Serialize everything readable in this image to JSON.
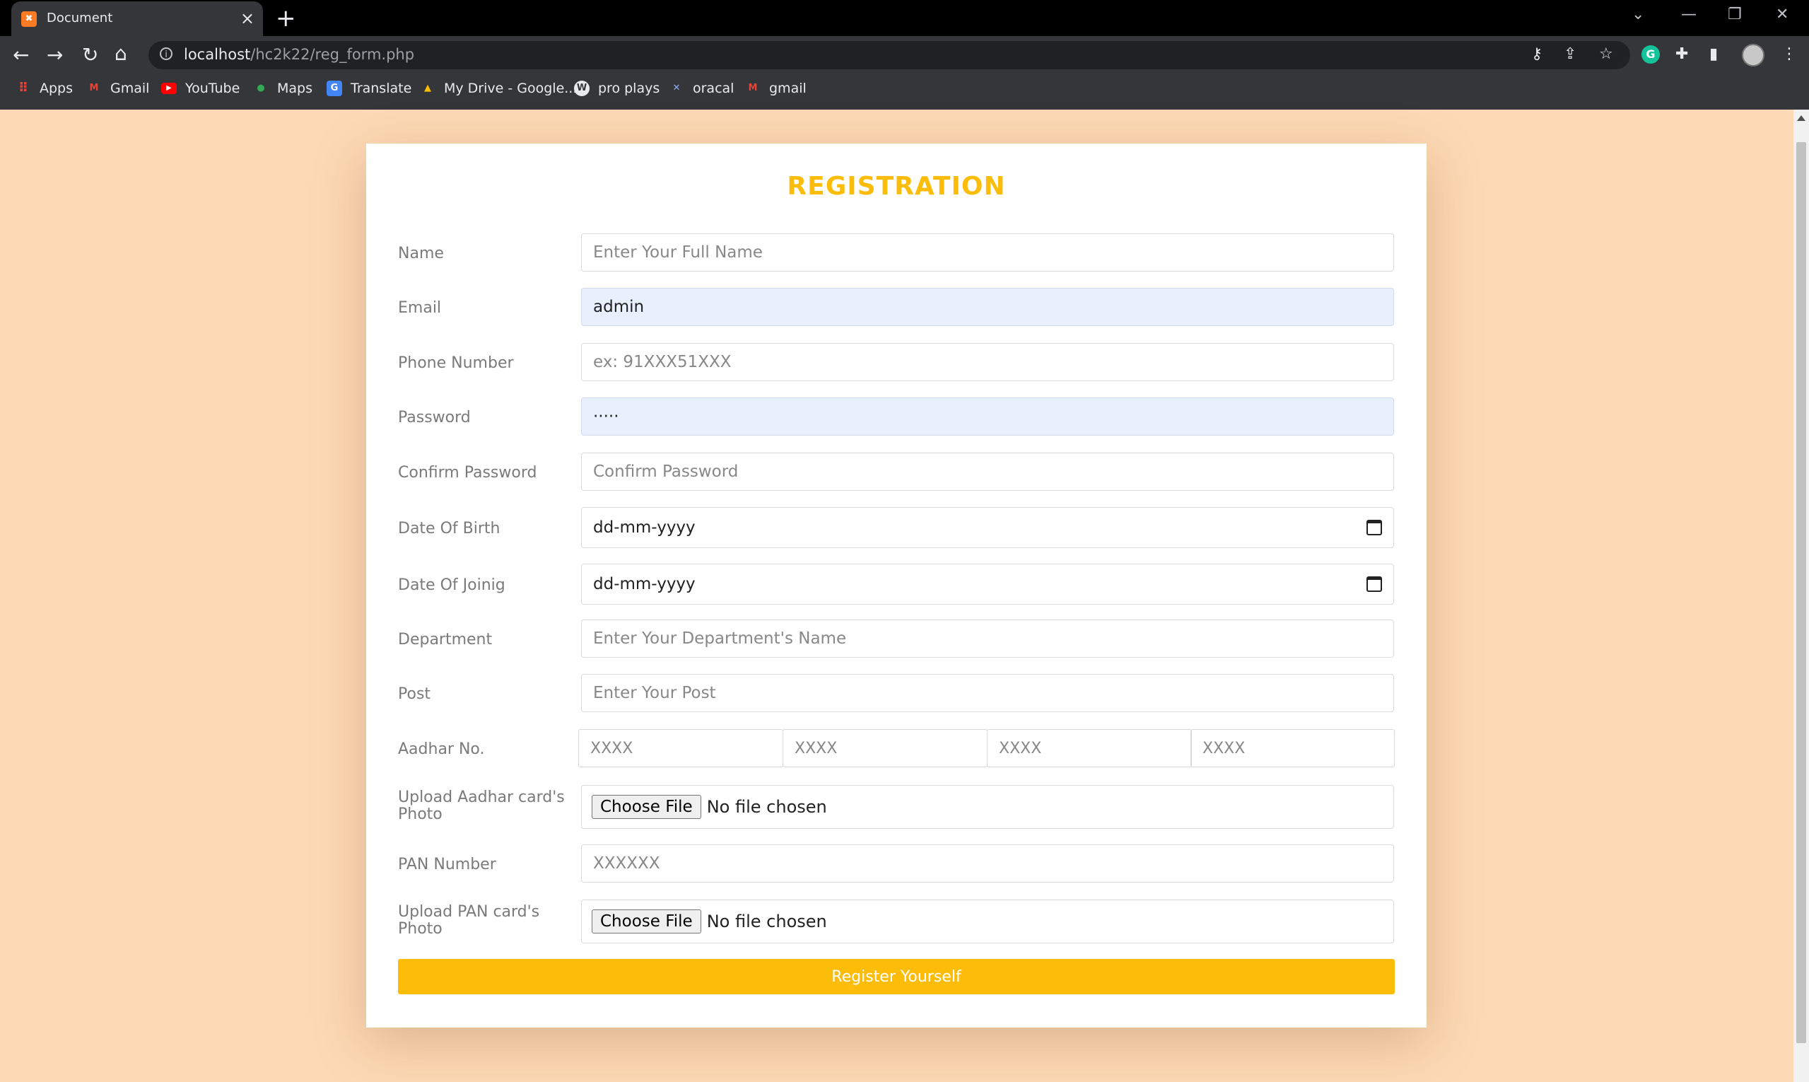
{
  "browser": {
    "tab_title": "Document",
    "tab_favicon": "XAMPP",
    "url_host": "localhost",
    "url_path": "/hc2k22/reg_form.php",
    "bookmarks": [
      {
        "label": "Apps",
        "icon": "apps-grid-icon",
        "color": "#ea4335"
      },
      {
        "label": "Gmail",
        "icon": "gmail-icon",
        "color": "#ea4335"
      },
      {
        "label": "YouTube",
        "icon": "youtube-icon",
        "color": "#ff0000"
      },
      {
        "label": "Maps",
        "icon": "maps-icon",
        "color": "#34a853"
      },
      {
        "label": "Translate",
        "icon": "translate-icon",
        "color": "#4285f4"
      },
      {
        "label": "My Drive - Google...",
        "icon": "drive-icon",
        "color": "#fbbc04"
      },
      {
        "label": "pro plays",
        "icon": "wordpress-icon",
        "color": "#e8eaed"
      },
      {
        "label": "oracal",
        "icon": "oracle-icon",
        "color": "#8ab4f8"
      },
      {
        "label": "gmail",
        "icon": "gmail-icon",
        "color": "#ea4335"
      }
    ]
  },
  "form": {
    "title": "REGISTRATION",
    "accent": "#fbbd0a",
    "name": {
      "label": "Name",
      "placeholder": "Enter Your Full Name"
    },
    "email": {
      "label": "Email",
      "value": "admin"
    },
    "phone": {
      "label": "Phone Number",
      "placeholder": "ex: 91XXX51XXX"
    },
    "password": {
      "label": "Password",
      "value": "·····"
    },
    "confirm_password": {
      "label": "Confirm Password",
      "placeholder": "Confirm Password"
    },
    "dob": {
      "label": "Date Of Birth",
      "value": "dd-mm-yyyy"
    },
    "doj": {
      "label": "Date Of Joinig",
      "value": "dd-mm-yyyy"
    },
    "department": {
      "label": "Department",
      "placeholder": "Enter Your Department's Name"
    },
    "post": {
      "label": "Post",
      "placeholder": "Enter Your Post"
    },
    "aadhar": {
      "label": "Aadhar No.",
      "parts": [
        "XXXX",
        "XXXX",
        "XXXX",
        "XXXX"
      ]
    },
    "aadhar_photo": {
      "label": "Upload Aadhar card's Photo",
      "button": "Choose File",
      "status": "No file chosen"
    },
    "pan": {
      "label": "PAN Number",
      "placeholder": "XXXXXX"
    },
    "pan_photo": {
      "label": "Upload PAN card's Photo",
      "button": "Choose File",
      "status": "No file chosen"
    },
    "submit_label": "Register Yourself"
  }
}
